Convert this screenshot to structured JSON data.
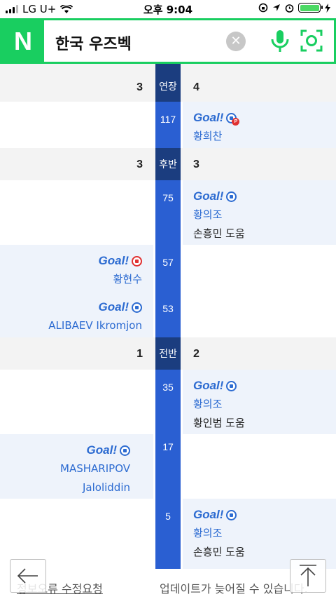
{
  "status_bar": {
    "carrier": "LG U+",
    "time": "오후 9:04"
  },
  "search": {
    "query": "한국 우즈벡",
    "logo": "N"
  },
  "timeline": {
    "extra_time": {
      "label": "연장",
      "home": "3",
      "away": "4"
    },
    "e117": {
      "minute": "117",
      "goal": "Goal!",
      "scorer": "황희찬"
    },
    "second_half": {
      "label": "후반",
      "home": "3",
      "away": "3"
    },
    "e75": {
      "minute": "75",
      "goal": "Goal!",
      "scorer": "황의조",
      "assist": "손흥민 도움"
    },
    "e57": {
      "minute": "57",
      "goal": "Goal!",
      "scorer": "황현수"
    },
    "e53": {
      "minute": "53",
      "goal": "Goal!",
      "scorer": "ALIBAEV Ikromjon"
    },
    "first_half": {
      "label": "전반",
      "home": "1",
      "away": "2"
    },
    "e35": {
      "minute": "35",
      "goal": "Goal!",
      "scorer": "황의조",
      "assist": "황인범 도움"
    },
    "e17": {
      "minute": "17",
      "goal": "Goal!",
      "scorer_line1": "MASHARIPOV",
      "scorer_line2": "Jaloliddin"
    },
    "e5": {
      "minute": "5",
      "goal": "Goal!",
      "scorer": "황의조",
      "assist": "손흥민 도움"
    }
  },
  "footer": {
    "report": "정보오류 수정요청",
    "update": "업데이트가 늦어질 수 있습니다."
  },
  "icons": {
    "ball_home": "soccer-ball-icon",
    "ball_own_goal": "red-soccer-ball-icon",
    "penalty": "penalty-badge-icon"
  },
  "colors": {
    "brand": "#19ce60",
    "timeline_bar": "#2a5fd2",
    "period_bar": "#1b3d7f",
    "goal_text": "#2c6bd1"
  }
}
